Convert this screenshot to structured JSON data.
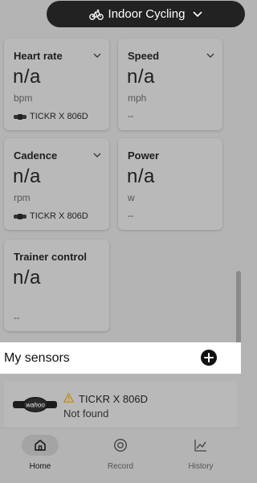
{
  "header": {
    "activity_label": "Indoor Cycling",
    "activity_icon": "bike-icon",
    "dropdown_icon": "chevron-down-icon"
  },
  "cards": {
    "heart_rate": {
      "label": "Heart rate",
      "value": "n/a",
      "unit": "bpm",
      "sensor": "TICKR X 806D"
    },
    "speed": {
      "label": "Speed",
      "value": "n/a",
      "unit": "mph",
      "sensor": "--"
    },
    "cadence": {
      "label": "Cadence",
      "value": "n/a",
      "unit": "rpm",
      "sensor": "TICKR X 806D"
    },
    "power": {
      "label": "Power",
      "value": "n/a",
      "unit": "w",
      "sensor": "--"
    },
    "trainer": {
      "label": "Trainer control",
      "value": "n/a",
      "sensor": "--"
    }
  },
  "sensors_section": {
    "title": "My sensors",
    "add_icon": "plus-circle-icon"
  },
  "sensor_list": [
    {
      "name": "TICKR X 806D",
      "status": "Not found",
      "status_icon": "warning-icon",
      "device_logo": "wahoo"
    }
  ],
  "nav": {
    "home": "Home",
    "record": "Record",
    "history": "History"
  },
  "colors": {
    "accent_dark": "#222222",
    "warning": "#c58a00",
    "highlight_band": "#ffffff"
  }
}
